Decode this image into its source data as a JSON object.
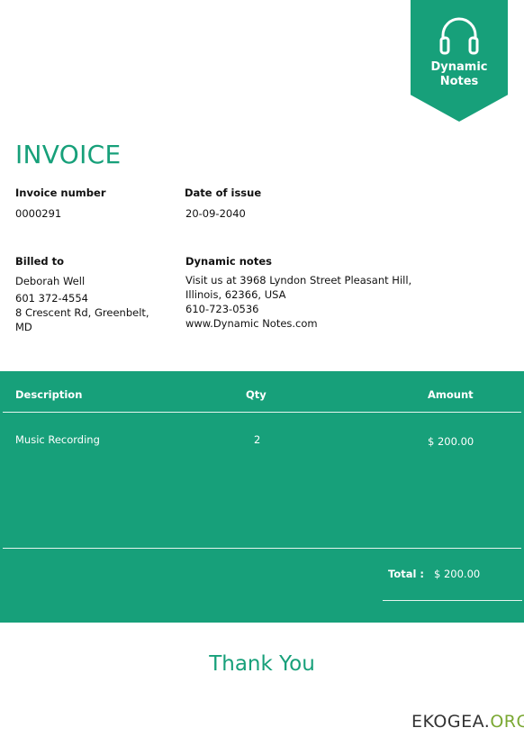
{
  "brand": {
    "line1": "Dynamic",
    "line2": "Notes",
    "color": "#17a07a"
  },
  "title": "INVOICE",
  "meta": {
    "invoice_number_label": "Invoice number",
    "invoice_number": "0000291",
    "date_label": "Date of issue",
    "date": "20-09-2040"
  },
  "billed_to": {
    "label": "Billed to",
    "name": "Deborah Well",
    "phone": "601 372-4554",
    "address_line1": "8 Crescent Rd, Greenbelt,",
    "address_line2": "MD"
  },
  "company": {
    "label": "Dynamic notes",
    "address_line1": "Visit us at 3968 Lyndon Street Pleasant Hill,",
    "address_line2": "Illinois, 62366, USA",
    "phone": "610-723-0536",
    "website": "www.Dynamic Notes.com"
  },
  "table": {
    "headers": {
      "description": "Description",
      "qty": "Qty",
      "amount": "Amount"
    },
    "rows": [
      {
        "description": "Music Recording",
        "qty": "2",
        "amount": "$ 200.00"
      }
    ],
    "total_label": "Total :",
    "total_value": "$ 200.00"
  },
  "thank_you": "Thank You",
  "watermark": {
    "part1": "EKOGEA.",
    "part2": "ORG"
  }
}
